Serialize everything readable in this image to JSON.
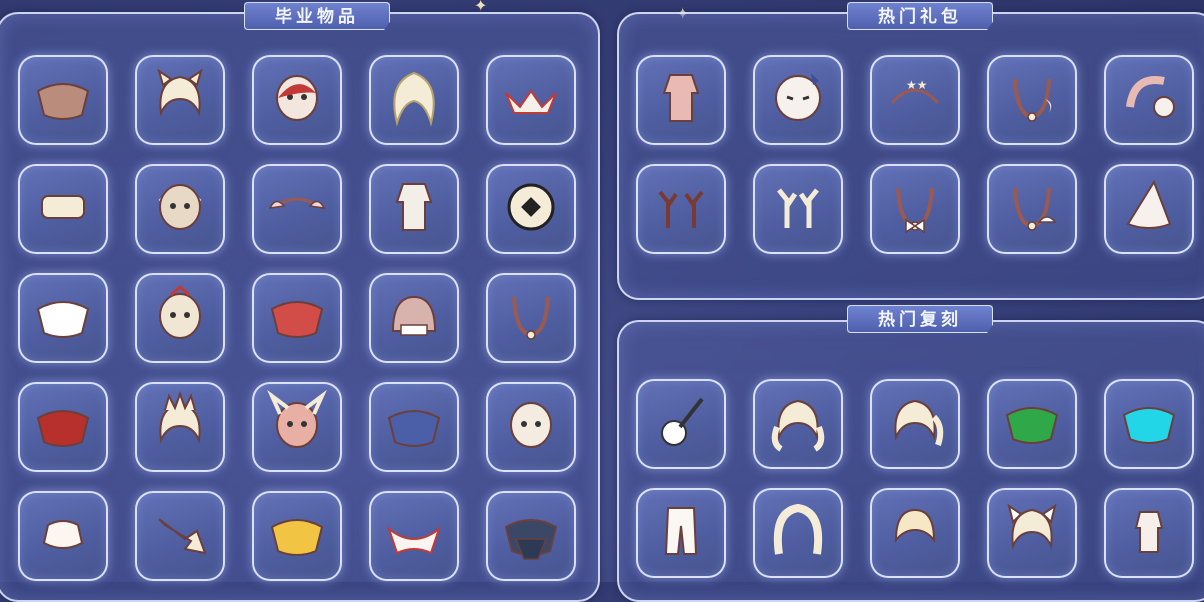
{
  "sections": {
    "graduation": {
      "title": "毕业物品",
      "items": [
        "bat-cape-icon",
        "cat-ears-hair-icon",
        "mask-icon",
        "long-hair-icon",
        "jester-collar-icon",
        "drum-instrument-icon",
        "crescent-mask-icon",
        "wing-headband-icon",
        "outfit-icon",
        "round-seal-icon",
        "white-cape-icon",
        "owl-mask-icon",
        "red-cape-icon",
        "hood-icon",
        "necklace-icon",
        "red-cloak-icon",
        "spiky-hair-icon",
        "horned-mask-icon",
        "blue-cape-icon",
        "skull-mask-icon",
        "hat-icon",
        "horn-instrument-icon",
        "yellow-cape-icon",
        "wing-collar-icon",
        "dark-layered-cape-icon"
      ]
    },
    "hot_gift": {
      "title": "热门礼包",
      "items": [
        "pink-outfit-icon",
        "round-mask-icon",
        "star-crown-headband-icon",
        "moon-necklace-icon",
        "earmuff-icon",
        "antlers-icon",
        "branch-horns-icon",
        "bow-necklace-icon",
        "jellyfish-necklace-icon",
        "wizard-hat-icon"
      ]
    },
    "hot_rerun": {
      "title": "热门复刻",
      "items": [
        "guitar-icon",
        "twin-tail-hair-icon",
        "ponytail-hair-icon",
        "green-cape-icon",
        "cyan-cape-icon",
        "pants-icon",
        "curly-hair-icon",
        "bob-hair-icon",
        "cat-ear-hair-icon",
        "small-outfit-icon"
      ]
    }
  },
  "colors": {
    "background": "#39427c",
    "slot": "#5564a8",
    "border": "#e6ecff",
    "tab": "#5f72c2"
  }
}
